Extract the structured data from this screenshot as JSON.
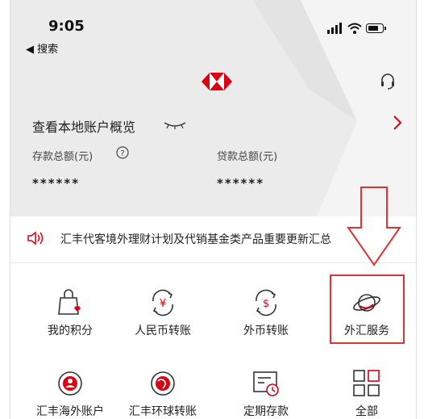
{
  "status_bar": {
    "time": "9:05",
    "back_label": "◀ 搜索"
  },
  "overview": {
    "title": "查看本地账户概览",
    "deposit_label": "存款总额(元)",
    "deposit_value": "******",
    "loan_label": "贷款总额(元)",
    "loan_value": "******"
  },
  "notice": {
    "text": "汇丰代客境外理财计划及代销基金类产品重要更新汇总"
  },
  "services": [
    {
      "label": "我的积分",
      "icon": "points-bag-icon"
    },
    {
      "label": "人民币转账",
      "icon": "rmb-transfer-icon"
    },
    {
      "label": "外币转账",
      "icon": "foreign-currency-transfer-icon"
    },
    {
      "label": "外汇服务",
      "icon": "fx-planet-icon"
    },
    {
      "label": "汇丰海外账户",
      "icon": "overseas-account-icon"
    },
    {
      "label": "汇丰环球转账",
      "icon": "global-transfer-icon"
    },
    {
      "label": "定期存款",
      "icon": "time-deposit-icon"
    },
    {
      "label": "全部",
      "icon": "all-grid-icon"
    }
  ],
  "colors": {
    "brand_red": "#db0011",
    "annotation_red": "#dd3333",
    "hero_bg": "#ebebeb"
  }
}
